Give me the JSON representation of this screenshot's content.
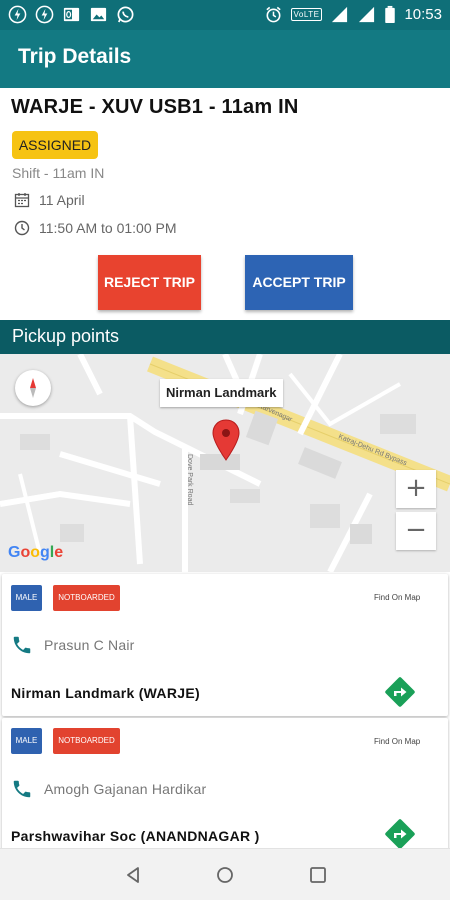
{
  "status_bar": {
    "time": "10:53",
    "volte": "VoLTE",
    "left_icons": [
      "app-icon-1",
      "app-icon-2",
      "outlook-icon",
      "gallery-icon",
      "whatsapp-icon"
    ],
    "right_icons": [
      "alarm-icon",
      "volte-icon",
      "signal-icon",
      "battery-icon"
    ]
  },
  "app_bar": {
    "title": "Trip Details"
  },
  "trip": {
    "title": "WARJE - XUV USB1 - 11am IN",
    "status": "ASSIGNED",
    "shift": "Shift - 11am IN",
    "date": "11 April",
    "time_range": "11:50 AM to 01:00 PM"
  },
  "actions": {
    "reject_label": "REJECT TRIP",
    "accept_label": "ACCEPT TRIP"
  },
  "pickup": {
    "header": "Pickup points",
    "map": {
      "marker_label": "Nirman Landmark",
      "road_label_1": "Karvenagar",
      "road_label_2": "Katraj-Dehu Rd Bypass",
      "road_label_3": "Dove Park Road",
      "zoom_in": "+",
      "zoom_out": "−",
      "google": [
        "G",
        "o",
        "o",
        "g",
        "l",
        "e"
      ],
      "google_colors": [
        "#4285f4",
        "#ea4335",
        "#fbbc05",
        "#4285f4",
        "#34a853",
        "#ea4335"
      ]
    },
    "points": [
      {
        "gender": "MALE",
        "status": "NOTBOARDED",
        "find_on_map": "Find On Map",
        "name": "Prasun C Nair",
        "location": "Nirman Landmark (WARJE)"
      },
      {
        "gender": "MALE",
        "status": "NOTBOARDED",
        "find_on_map": "Find On Map",
        "name": "Amogh Gajanan Hardikar",
        "location": "Parshwavihar Soc (ANANDNAGAR )"
      }
    ]
  },
  "colors": {
    "primary": "#137a83",
    "status_bar": "#0f6f78",
    "pickup_header": "#0b5b63",
    "assigned": "#f6c313",
    "reject": "#e8432f",
    "accept": "#2d64b4",
    "direction": "#1aa058"
  }
}
